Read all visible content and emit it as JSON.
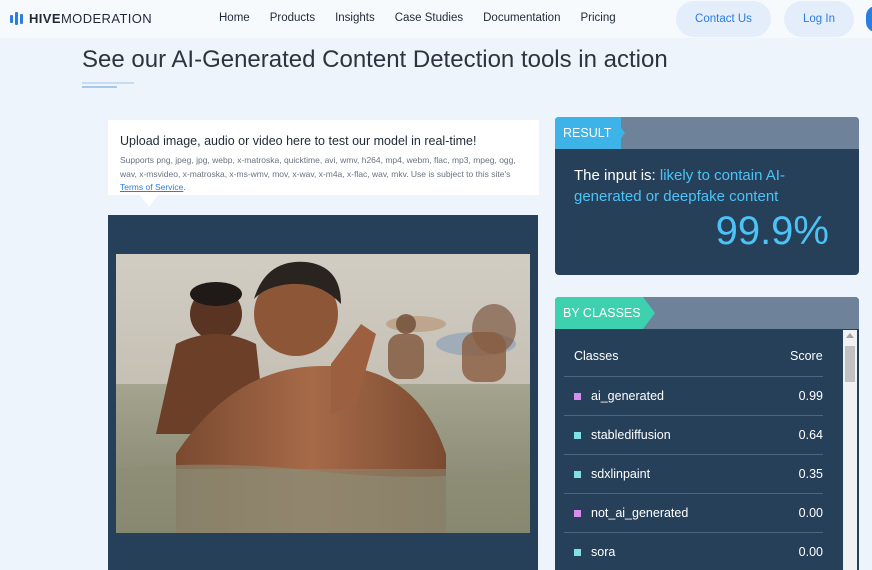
{
  "brand": {
    "name_bold": "HIVE",
    "name_rest": "MODERATION"
  },
  "nav": {
    "links": [
      "Home",
      "Products",
      "Insights",
      "Case Studies",
      "Documentation",
      "Pricing"
    ],
    "contact_label": "Contact Us",
    "login_label": "Log In"
  },
  "page": {
    "headline": "See our AI-Generated Content Detection tools in action"
  },
  "upload": {
    "title": "Upload image, audio or video here to test our model in real-time!",
    "description": "Supports png, jpeg, jpg, webp, x-matroska, quicktime, avi, wmv, h264, mp4, webm, flac, mp3, mpeg, ogg, wav, x-msvideo, x-matroska, x-ms-wmv, mov, x-wav, x-m4a, x-flac, wav, mkv. Use is subject to this site's",
    "terms_link": "Terms of Service",
    "terms_suffix": "."
  },
  "result": {
    "tag": "RESULT",
    "prefix": "The input is:",
    "verdict": "likely to contain AI-generated or deepfake content",
    "score": "99.9%"
  },
  "classes": {
    "tag": "BY CLASSES",
    "col_classes": "Classes",
    "col_score": "Score",
    "rows": [
      {
        "name": "ai_generated",
        "score": "0.99",
        "color": "#d88cf0"
      },
      {
        "name": "stablediffusion",
        "score": "0.64",
        "color": "#7fe0e6"
      },
      {
        "name": "sdxlinpaint",
        "score": "0.35",
        "color": "#7fe0e6"
      },
      {
        "name": "not_ai_generated",
        "score": "0.00",
        "color": "#d88cf0"
      },
      {
        "name": "sora",
        "score": "0.00",
        "color": "#7fe0e6"
      }
    ]
  },
  "colors": {
    "accent": "#2a7de1",
    "panel": "#27405a",
    "result_tag": "#3db3e8",
    "classes_tag": "#3ed1b0",
    "highlight": "#4cc3f7"
  }
}
